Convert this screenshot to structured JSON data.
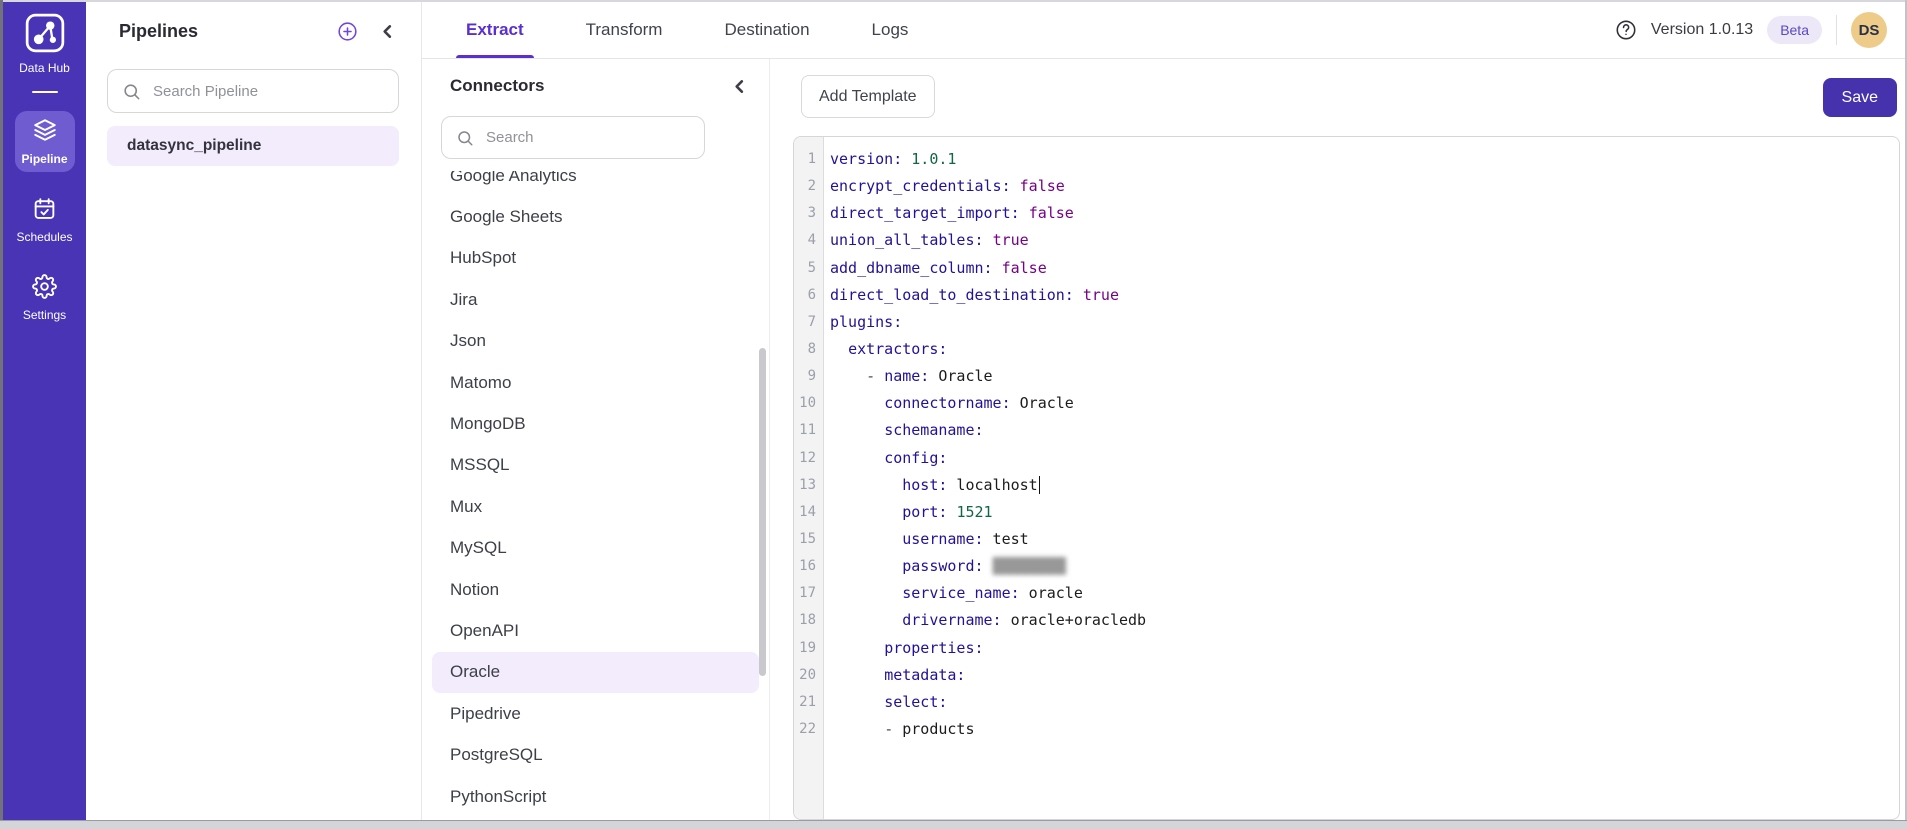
{
  "theme": {
    "sidebar_bg": "#4834b4",
    "sidebar_active_bg": "#6e5cd0",
    "accent": "#5a2fd2",
    "save_bg": "#4632ad",
    "selection_bg": "#f3ecfd",
    "beta_bg": "#ece8f8",
    "beta_text": "#5a49c1",
    "avatar_bg": "#efcb8a",
    "avatar_text": "#27324a"
  },
  "sidebar": {
    "logo_label": "Data Hub",
    "items": [
      {
        "id": "pipeline",
        "label": "Pipeline",
        "icon": "layers-icon",
        "active": true
      },
      {
        "id": "schedules",
        "label": "Schedules",
        "icon": "calendar-check-icon",
        "active": false
      },
      {
        "id": "settings",
        "label": "Settings",
        "icon": "gear-icon",
        "active": false
      }
    ]
  },
  "pipelines_panel": {
    "title": "Pipelines",
    "search_placeholder": "Search Pipeline",
    "items": [
      {
        "name": "datasync_pipeline",
        "selected": true
      }
    ]
  },
  "tabs": [
    {
      "label": "Extract",
      "active": true
    },
    {
      "label": "Transform",
      "active": false
    },
    {
      "label": "Destination",
      "active": false
    },
    {
      "label": "Logs",
      "active": false
    }
  ],
  "header_right": {
    "version": "Version 1.0.13",
    "beta_badge": "Beta",
    "avatar_initials": "DS"
  },
  "connectors_panel": {
    "title": "Connectors",
    "search_placeholder": "Search",
    "items": [
      "Google Analytics",
      "Google Sheets",
      "HubSpot",
      "Jira",
      "Json",
      "Matomo",
      "MongoDB",
      "MSSQL",
      "Mux",
      "MySQL",
      "Notion",
      "OpenAPI",
      "Oracle",
      "Pipedrive",
      "PostgreSQL",
      "PythonScript"
    ],
    "selected_item": "Oracle"
  },
  "toolbar": {
    "add_template_label": "Add Template",
    "save_label": "Save"
  },
  "editor": {
    "language": "yaml",
    "colors": {
      "key": "#221199",
      "num": "#116644",
      "bool": "#770088",
      "plain": "#1c1c1c",
      "dash": "#4a4a4a",
      "masked": "#989898",
      "line_number": "#9aa0a8",
      "gutter_bg": "#f3f3f4",
      "gutter_border": "#dcdcde"
    },
    "lines": [
      {
        "segs": [
          [
            "k",
            "version:"
          ],
          [
            "p",
            " "
          ],
          [
            "n",
            "1.0.1"
          ]
        ]
      },
      {
        "segs": [
          [
            "k",
            "encrypt_credentials:"
          ],
          [
            "p",
            " "
          ],
          [
            "b",
            "false"
          ]
        ]
      },
      {
        "segs": [
          [
            "k",
            "direct_target_import:"
          ],
          [
            "p",
            " "
          ],
          [
            "b",
            "false"
          ]
        ]
      },
      {
        "segs": [
          [
            "k",
            "union_all_tables:"
          ],
          [
            "p",
            " "
          ],
          [
            "b",
            "true"
          ]
        ]
      },
      {
        "segs": [
          [
            "k",
            "add_dbname_column:"
          ],
          [
            "p",
            " "
          ],
          [
            "b",
            "false"
          ]
        ]
      },
      {
        "segs": [
          [
            "k",
            "direct_load_to_destination:"
          ],
          [
            "p",
            " "
          ],
          [
            "b",
            "true"
          ]
        ]
      },
      {
        "segs": [
          [
            "k",
            "plugins:"
          ]
        ]
      },
      {
        "segs": [
          [
            "p",
            "  "
          ],
          [
            "k",
            "extractors:"
          ]
        ]
      },
      {
        "segs": [
          [
            "p",
            "    "
          ],
          [
            "d",
            "- "
          ],
          [
            "k",
            "name:"
          ],
          [
            "p",
            " Oracle"
          ]
        ]
      },
      {
        "segs": [
          [
            "p",
            "      "
          ],
          [
            "k",
            "connectorname:"
          ],
          [
            "p",
            " Oracle"
          ]
        ]
      },
      {
        "segs": [
          [
            "p",
            "      "
          ],
          [
            "k",
            "schemaname:"
          ]
        ]
      },
      {
        "segs": [
          [
            "p",
            "      "
          ],
          [
            "k",
            "config:"
          ]
        ]
      },
      {
        "segs": [
          [
            "p",
            "        "
          ],
          [
            "k",
            "host:"
          ],
          [
            "p",
            " localhost"
          ],
          [
            "c",
            ""
          ]
        ]
      },
      {
        "segs": [
          [
            "p",
            "        "
          ],
          [
            "k",
            "port:"
          ],
          [
            "p",
            " "
          ],
          [
            "n",
            "1521"
          ]
        ]
      },
      {
        "segs": [
          [
            "p",
            "        "
          ],
          [
            "k",
            "username:"
          ],
          [
            "p",
            " test"
          ]
        ]
      },
      {
        "segs": [
          [
            "p",
            "        "
          ],
          [
            "k",
            "password:"
          ],
          [
            "p",
            " "
          ],
          [
            "m",
            "█████████"
          ]
        ]
      },
      {
        "segs": [
          [
            "p",
            "        "
          ],
          [
            "k",
            "service_name:"
          ],
          [
            "p",
            " oracle"
          ]
        ]
      },
      {
        "segs": [
          [
            "p",
            "        "
          ],
          [
            "k",
            "drivername:"
          ],
          [
            "p",
            " oracle+oracledb"
          ]
        ]
      },
      {
        "segs": [
          [
            "p",
            "      "
          ],
          [
            "k",
            "properties:"
          ]
        ]
      },
      {
        "segs": [
          [
            "p",
            "      "
          ],
          [
            "k",
            "metadata:"
          ]
        ]
      },
      {
        "segs": [
          [
            "p",
            "      "
          ],
          [
            "k",
            "select:"
          ]
        ]
      },
      {
        "segs": [
          [
            "p",
            "      "
          ],
          [
            "d",
            "- "
          ],
          [
            "p",
            "products"
          ]
        ]
      }
    ]
  }
}
